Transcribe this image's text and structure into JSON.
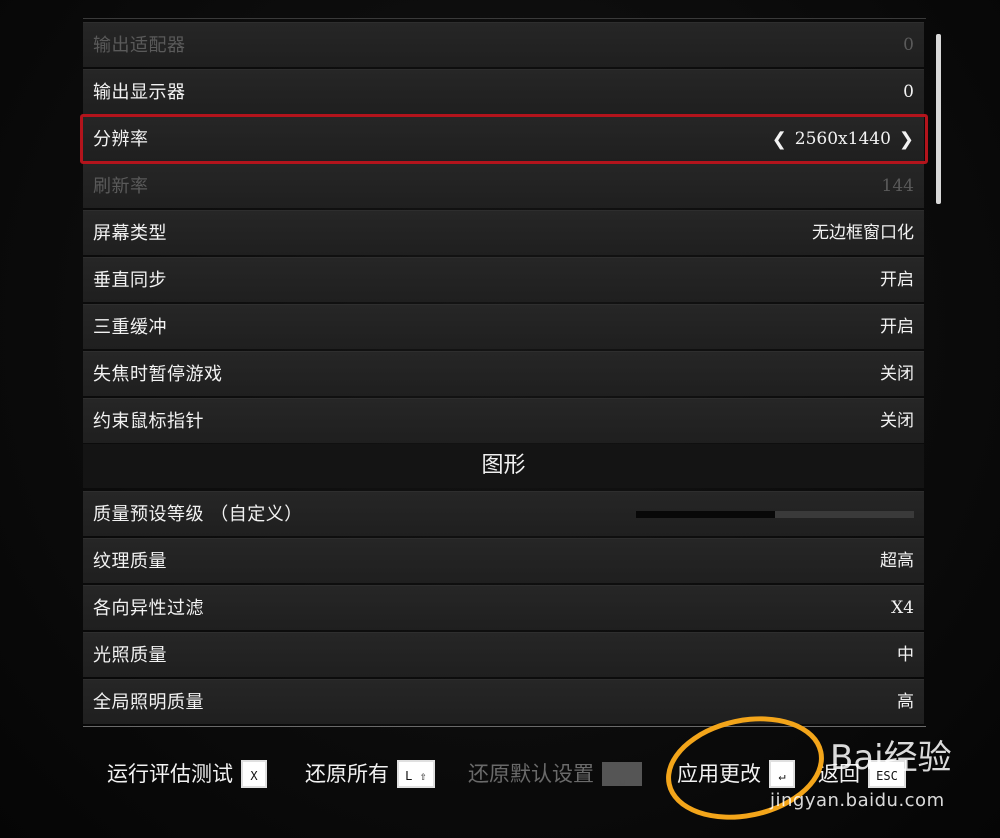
{
  "display_rows": [
    {
      "label": "输出适配器",
      "value": "0",
      "disabled": true
    },
    {
      "label": "输出显示器",
      "value": "0",
      "disabled": false
    },
    {
      "label": "分辨率",
      "value": "2560x1440",
      "disabled": false,
      "selected": true
    },
    {
      "label": "刷新率",
      "value": "144",
      "disabled": true
    },
    {
      "label": "屏幕类型",
      "value": "无边框窗口化",
      "disabled": false
    },
    {
      "label": "垂直同步",
      "value": "开启",
      "disabled": false
    },
    {
      "label": "三重缓冲",
      "value": "开启",
      "disabled": false
    },
    {
      "label": "失焦时暂停游戏",
      "value": "关闭",
      "disabled": false
    },
    {
      "label": "约束鼠标指针",
      "value": "关闭",
      "disabled": false
    }
  ],
  "graphics_header": "图形",
  "graphics_rows": [
    {
      "label": "质量预设等级 （自定义）",
      "slider_fraction": 0.5
    },
    {
      "label": "纹理质量",
      "value": "超高"
    },
    {
      "label": "各向异性过滤",
      "value": "X4"
    },
    {
      "label": "光照质量",
      "value": "中"
    },
    {
      "label": "全局照明质量",
      "value": "高"
    }
  ],
  "footer": {
    "benchmark": {
      "label": "运行评估测试",
      "key": "X"
    },
    "restore_all": {
      "label": "还原所有",
      "key": "L ⇧"
    },
    "restore_default": {
      "label": "还原默认设置",
      "key": "␣",
      "disabled": true
    },
    "apply": {
      "label": "应用更改",
      "key": "↵"
    },
    "back": {
      "label": "返回",
      "key": "ESC"
    }
  },
  "watermark": {
    "logo": "Bai经验",
    "url": "jingyan.baidu.com"
  },
  "colors": {
    "highlight": "#b3141c",
    "annotation": "#f3a51a"
  }
}
